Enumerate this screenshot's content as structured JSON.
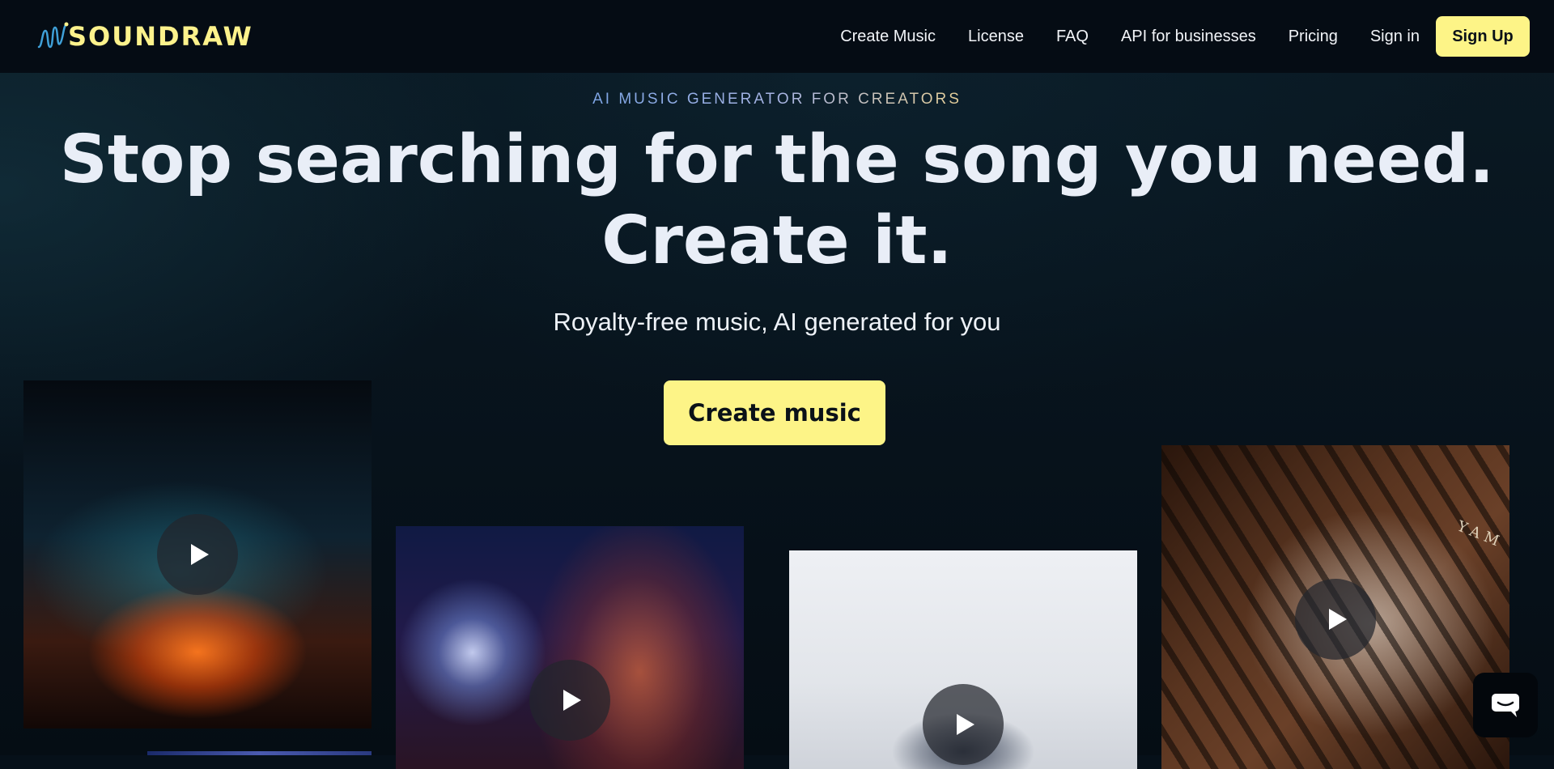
{
  "header": {
    "logo_text": "SOUNDRAW",
    "nav": [
      {
        "label": "Create Music"
      },
      {
        "label": "License"
      },
      {
        "label": "FAQ"
      },
      {
        "label": "API for businesses"
      },
      {
        "label": "Pricing"
      },
      {
        "label": "Sign in"
      }
    ],
    "signup_label": "Sign Up"
  },
  "hero": {
    "eyebrow": "AI MUSIC GENERATOR FOR CREATORS",
    "headline_line1": "Stop searching for the song you need.",
    "headline_line2": "Create it.",
    "subhead": "Royalty-free music, AI generated for you",
    "cta_label": "Create music"
  },
  "cards": [
    {
      "subject": "concert-lights",
      "icon": "play-icon"
    },
    {
      "subject": "disco-ball-woman",
      "icon": "play-icon"
    },
    {
      "subject": "dancer-white-room",
      "icon": "play-icon"
    },
    {
      "subject": "piano-hands",
      "icon": "play-icon",
      "brand_text": "YAM"
    }
  ],
  "chat": {
    "icon": "chat-bubble-icon"
  },
  "colors": {
    "brand_yellow": "#fdf487",
    "logo_yellow": "#fdf28c",
    "header_bg": "#050c14",
    "page_bg": "#061019",
    "eyebrow_blue": "#7fa6e6",
    "eyebrow_gold": "#e6cf98"
  }
}
